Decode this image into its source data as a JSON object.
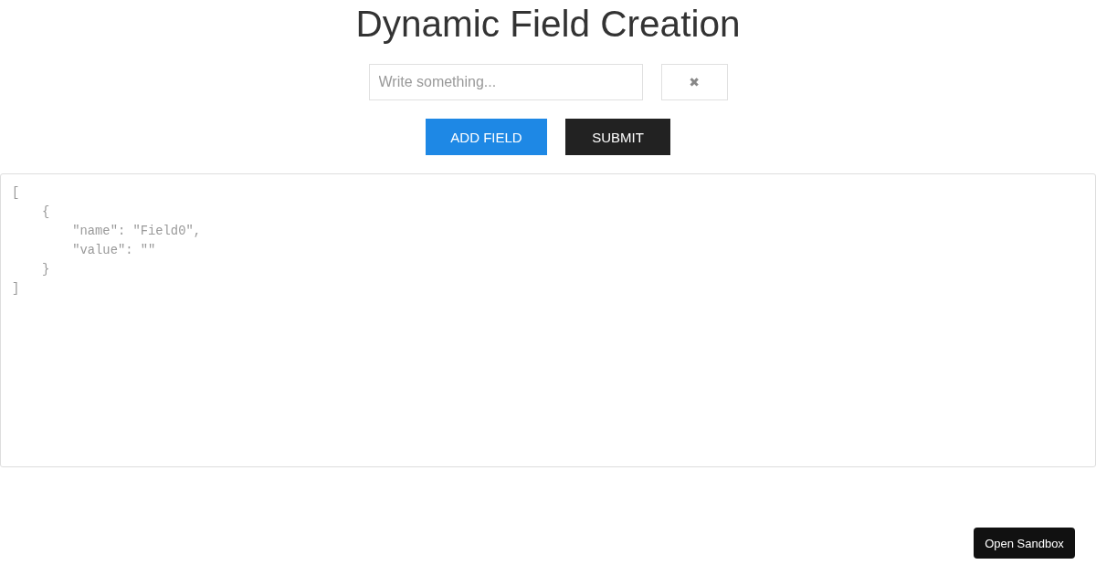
{
  "title": "Dynamic Field Creation",
  "fields": [
    {
      "placeholder": "Write something...",
      "remove_label": "✖"
    }
  ],
  "buttons": [
    {
      "kind": "primary",
      "label": "ADD FIELD"
    },
    {
      "kind": "dark",
      "label": "SUBMIT"
    }
  ],
  "output": {
    "text": "[\n    {\n        \"name\": \"Field0\",\n        \"value\": \"\"\n    }\n]"
  },
  "sandbox_button": {
    "label": "Open Sandbox"
  }
}
